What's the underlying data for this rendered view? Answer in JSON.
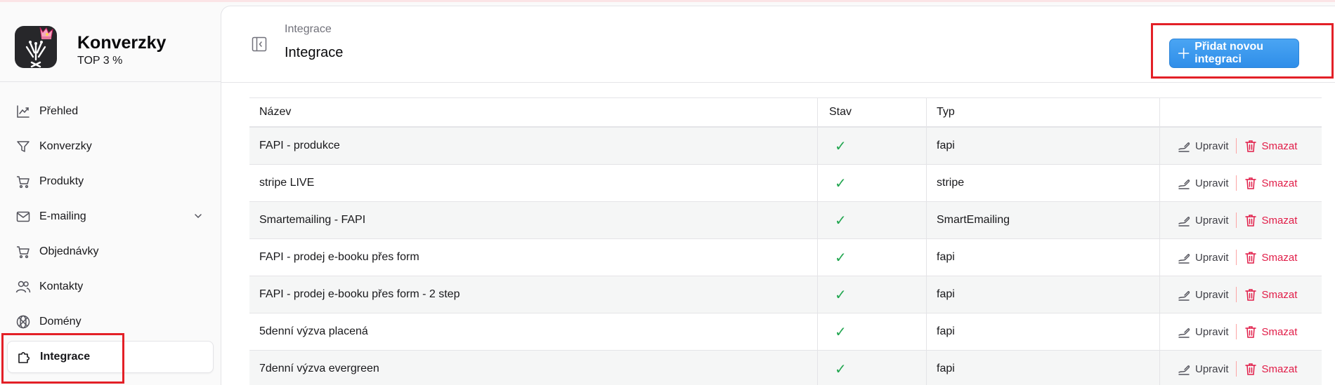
{
  "colors": {
    "accent": "#3b9cf0",
    "success": "#22a650",
    "danger": "#e11d48",
    "highlight_box": "#e32027"
  },
  "brand": {
    "name": "Konverzky",
    "subtitle": "TOP 3 %"
  },
  "sidebar": {
    "items": [
      {
        "label": "Přehled",
        "icon": "chart-line-icon"
      },
      {
        "label": "Konverzky",
        "icon": "funnel-icon"
      },
      {
        "label": "Produkty",
        "icon": "cart-icon"
      },
      {
        "label": "E-mailing",
        "icon": "mail-icon"
      },
      {
        "label": "Objednávky",
        "icon": "cart-icon"
      },
      {
        "label": "Kontakty",
        "icon": "users-icon"
      },
      {
        "label": "Domény",
        "icon": "globe-icon"
      },
      {
        "label": "Integrace",
        "icon": "puzzle-icon"
      }
    ],
    "active": "Integrace"
  },
  "header": {
    "breadcrumb": "Integrace",
    "title": "Integrace",
    "add_button_label": "Přidat novou integraci"
  },
  "table": {
    "columns": [
      "Název",
      "Stav",
      "Typ",
      ""
    ],
    "edit_label": "Upravit",
    "delete_label": "Smazat",
    "rows": [
      {
        "name": "FAPI - produkce",
        "status": "✓",
        "type": "fapi"
      },
      {
        "name": "stripe LIVE",
        "status": "✓",
        "type": "stripe"
      },
      {
        "name": "Smartemailing - FAPI",
        "status": "✓",
        "type": "SmartEmailing"
      },
      {
        "name": "FAPI - prodej e-booku přes form",
        "status": "✓",
        "type": "fapi"
      },
      {
        "name": "FAPI - prodej e-booku přes form - 2 step",
        "status": "✓",
        "type": "fapi"
      },
      {
        "name": "5denní výzva placená",
        "status": "✓",
        "type": "fapi"
      },
      {
        "name": "7denní výzva evergreen",
        "status": "✓",
        "type": "fapi"
      }
    ]
  }
}
